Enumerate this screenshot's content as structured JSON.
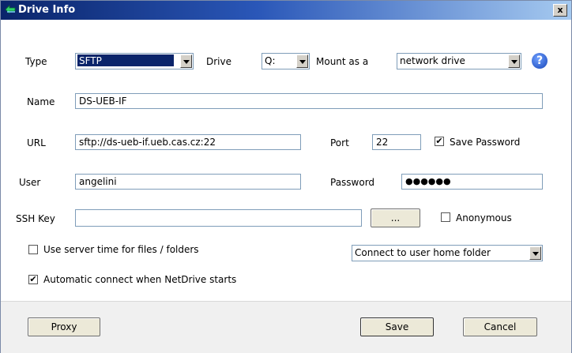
{
  "window": {
    "title": "Drive Info",
    "close_glyph": "x"
  },
  "type": {
    "label": "Type",
    "value": "SFTP"
  },
  "drive": {
    "label": "Drive",
    "value": "Q:"
  },
  "mount": {
    "label": "Mount as a",
    "value": "network drive"
  },
  "help_glyph": "?",
  "name": {
    "label": "Name",
    "value": "DS-UEB-IF"
  },
  "url": {
    "label": "URL",
    "value": "sftp://ds-ueb-if.ueb.cas.cz:22"
  },
  "port": {
    "label": "Port",
    "value": "22"
  },
  "save_password": {
    "label": "Save Password",
    "checked": true
  },
  "user": {
    "label": "User",
    "value": "angelini"
  },
  "password": {
    "label": "Password",
    "value": "●●●●●●"
  },
  "ssh_key": {
    "label": "SSH Key",
    "value": "",
    "browse_label": "..."
  },
  "anonymous": {
    "label": "Anonymous",
    "checked": false
  },
  "server_time": {
    "label": "Use server time for files / folders",
    "checked": false
  },
  "connect_folder": {
    "value": "Connect to user home folder"
  },
  "auto_connect": {
    "label": "Automatic connect when NetDrive starts",
    "checked": true
  },
  "buttons": {
    "proxy": "Proxy",
    "save": "Save",
    "cancel": "Cancel"
  },
  "check_glyph": "✔"
}
